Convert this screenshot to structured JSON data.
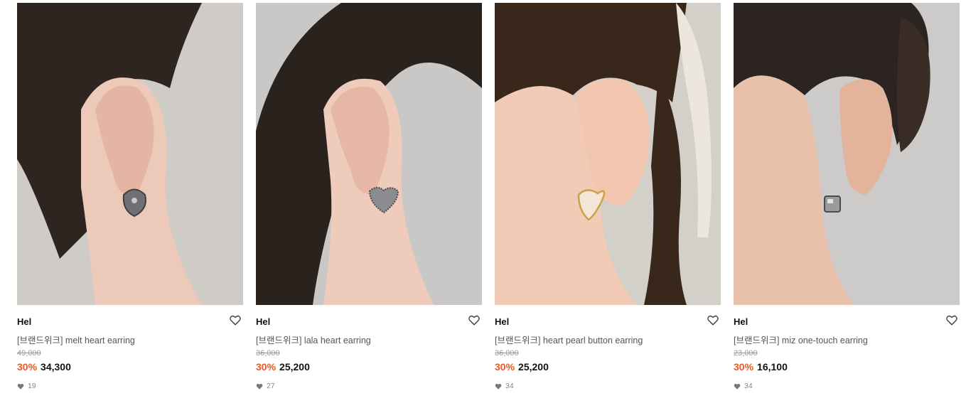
{
  "products": [
    {
      "brand": "Hel",
      "name": "[브랜드위크] melt heart earring",
      "original_price": "49,000",
      "discount": "30%",
      "price": "34,300",
      "likes": "19",
      "photo": {
        "bg": "#cfccc8",
        "hair": "#2e2520",
        "skin": "#ecc9b8",
        "earring": "#6f7073"
      }
    },
    {
      "brand": "Hel",
      "name": "[브랜드위크] lala heart earring",
      "original_price": "36,000",
      "discount": "30%",
      "price": "25,200",
      "likes": "27",
      "photo": {
        "bg": "#c9c8c6",
        "hair": "#2a221d",
        "skin": "#efcbbb",
        "earring": "#8b8c8f"
      }
    },
    {
      "brand": "Hel",
      "name": "[브랜드위크] heart pearl button earring",
      "original_price": "36,000",
      "discount": "30%",
      "price": "25,200",
      "likes": "34",
      "photo": {
        "bg": "#d3cfc9",
        "hair": "#3a271c",
        "skin": "#f1cbb6",
        "earring": "#f3e6d6"
      }
    },
    {
      "brand": "Hel",
      "name": "[브랜드위크] miz one-touch earring",
      "original_price": "23,000",
      "discount": "30%",
      "price": "16,100",
      "likes": "34",
      "photo": {
        "bg": "#cccbc9",
        "hair": "#2b2420",
        "skin": "#e9c0aa",
        "earring": "#9a9b9e"
      }
    }
  ],
  "icons": {
    "wishlist": "heart-outline-icon",
    "likes": "heart-filled-icon"
  },
  "colors": {
    "discount": "#e85a1e",
    "muted": "#999999"
  }
}
